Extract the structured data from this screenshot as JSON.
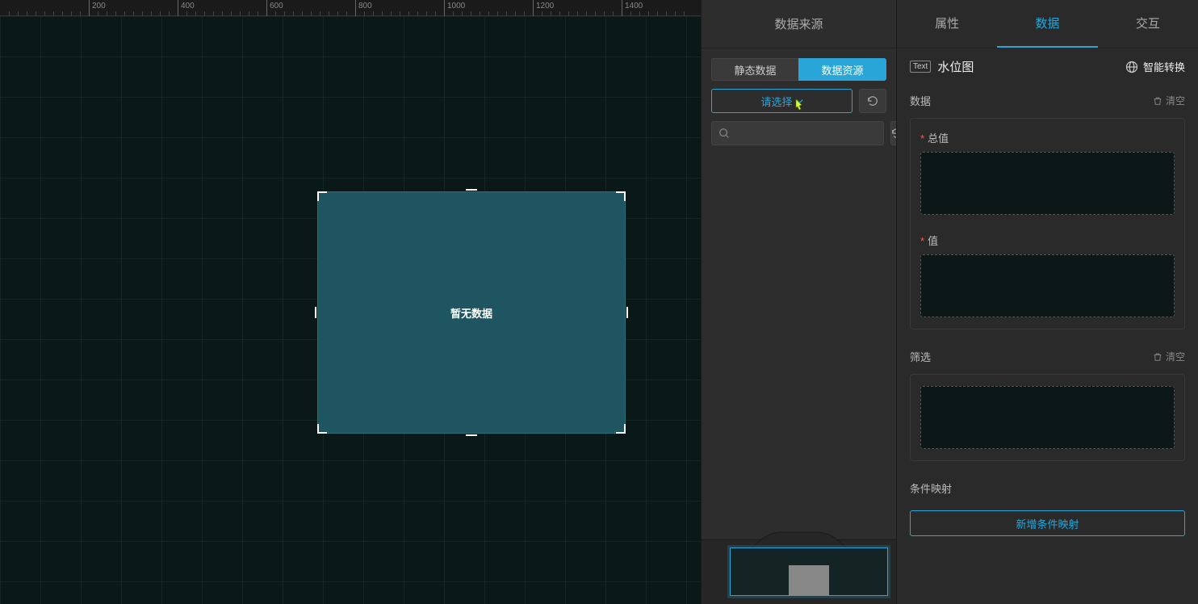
{
  "canvas": {
    "ruler_ticks": [
      200,
      400,
      600,
      800,
      1000,
      1200,
      1400
    ],
    "widget_placeholder": "暂无数据"
  },
  "ds_panel": {
    "title": "数据来源",
    "seg": {
      "static": "静态数据",
      "resource": "数据资源"
    },
    "select_label": "请选择"
  },
  "inspector": {
    "tabs": {
      "attr": "属性",
      "data": "数据",
      "interact": "交互"
    },
    "title": "水位图",
    "title_icon_text": "Text",
    "smart": "智能转换",
    "sections": {
      "data": {
        "label": "数据",
        "clear": "清空",
        "field_total": "总值",
        "field_value": "值"
      },
      "filter": {
        "label": "筛选",
        "clear": "清空"
      },
      "mapping": {
        "label": "条件映射",
        "add": "新增条件映射"
      }
    }
  }
}
